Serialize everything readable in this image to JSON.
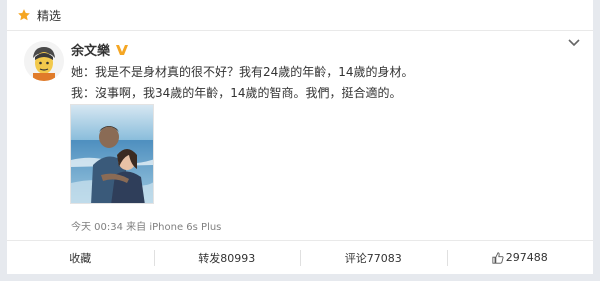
{
  "featured": {
    "label": "精选"
  },
  "post": {
    "username": "余文樂",
    "lines": [
      "她：我是不是身材真的很不好？我有24歲的年齡，14歲的身材。",
      "我：沒事啊，我34歲的年齡，14歲的智商。我們，挺合適的。"
    ],
    "meta": "今天 00:34 来自 iPhone 6s Plus"
  },
  "actions": {
    "collect": "收藏",
    "repost": "转发80993",
    "comment": "评论77083",
    "like": "297488"
  },
  "colors": {
    "accent": "#f5a623",
    "text": "#333333",
    "meta": "#808080",
    "background": "#e6e9ee"
  },
  "icons": [
    "star-icon",
    "verified-badge-icon",
    "chevron-down-icon",
    "thumbs-up-icon"
  ]
}
